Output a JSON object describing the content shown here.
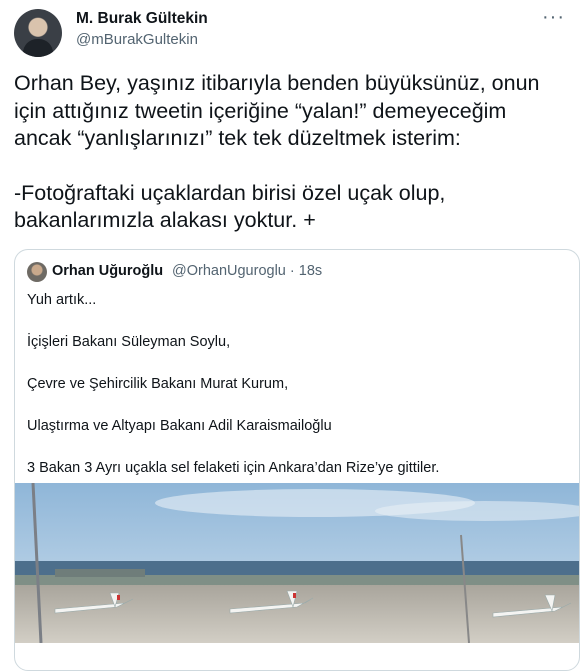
{
  "tweet": {
    "author_name": "M. Burak Gültekin",
    "author_handle": "@mBurakGultekin",
    "more_icon": "more-icon",
    "lines": [
      "Orhan Bey, yaşınız itibarıyla benden büyüksünüz, onun",
      "için attığınız tweetin içeriğine “yalan!” demeyeceğim",
      "ancak “yanlışlarınızı” tek tek düzeltmek isterim:",
      "-Fotoğraftaki uçaklardan birisi özel uçak olup,",
      "bakanlarımızla alakası yoktur. +"
    ]
  },
  "quoted": {
    "author_name": "Orhan Uğuroğlu",
    "author_handle": "@OrhanUguroglu",
    "separator": "·",
    "time": "18s",
    "lines": [
      "Yuh artık...",
      "İçişleri Bakanı Süleyman Soylu,",
      "Çevre ve Şehircilik Bakanı Murat Kurum,",
      "Ulaştırma ve Altyapı Bakanı Adil Karaismailoğlu",
      "3 Bakan 3 Ayrı uçakla sel felaketi için Ankara’dan Rize’ye gittiler."
    ]
  }
}
